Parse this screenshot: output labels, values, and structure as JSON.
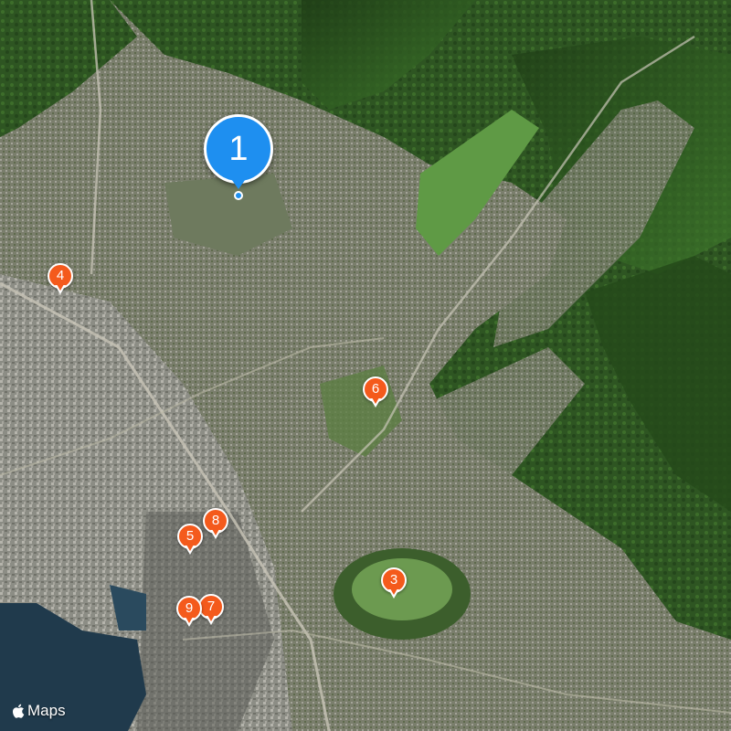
{
  "map": {
    "type": "satellite",
    "attribution": "Maps",
    "attribution_icon": "apple-logo-icon",
    "colors": {
      "selected_pin": "#1e8ff0",
      "pin": "#f45a1c",
      "water": "#203a4c",
      "vegetation": "#2f5a24",
      "urban": "#8e8f87"
    },
    "markers": [
      {
        "label": "1",
        "selected": true
      },
      {
        "label": "3",
        "selected": false
      },
      {
        "label": "4",
        "selected": false
      },
      {
        "label": "5",
        "selected": false
      },
      {
        "label": "6",
        "selected": false
      },
      {
        "label": "7",
        "selected": false
      },
      {
        "label": "8",
        "selected": false
      },
      {
        "label": "9",
        "selected": false
      }
    ]
  }
}
